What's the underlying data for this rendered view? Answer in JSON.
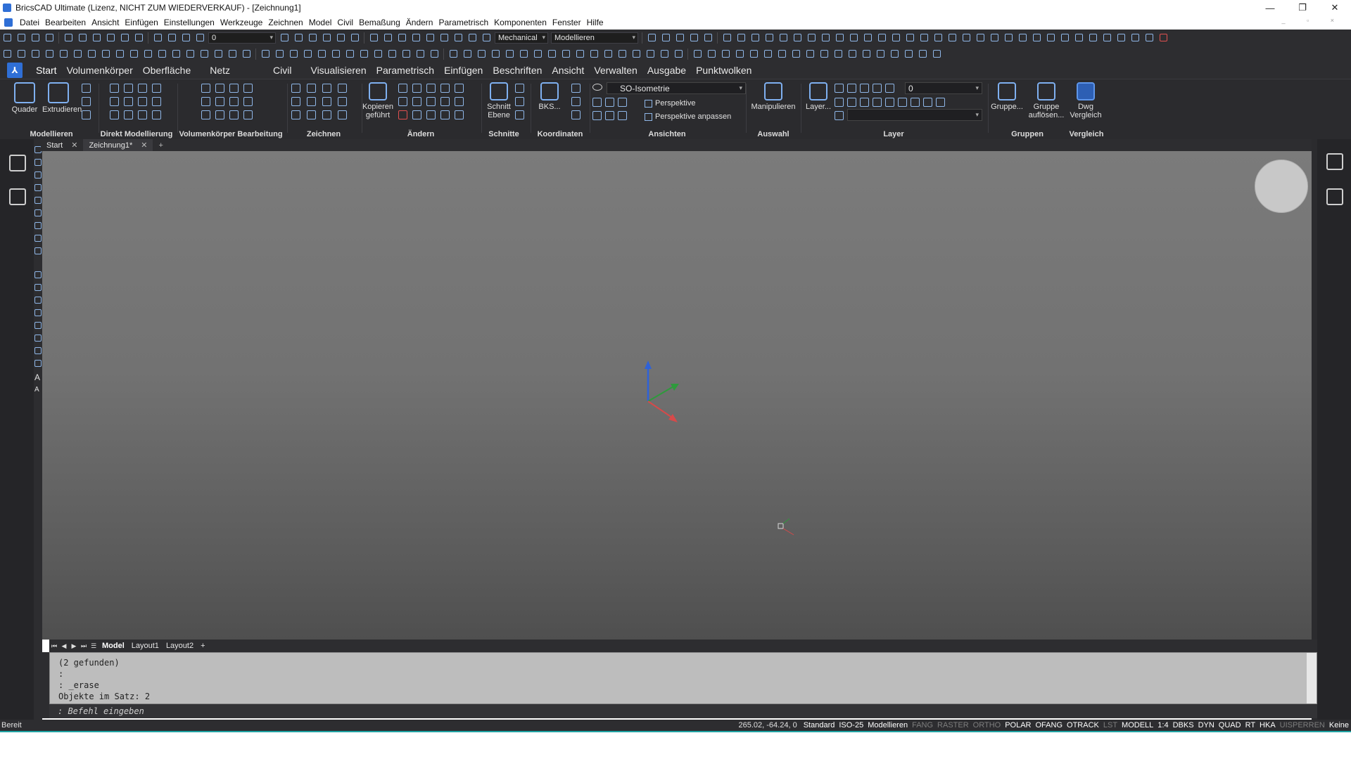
{
  "window": {
    "title": "BricsCAD Ultimate (Lizenz, NICHT ZUM WIEDERVERKAUF) - [Zeichnung1]",
    "controls": [
      "—",
      "❐",
      "✕"
    ]
  },
  "menubar": {
    "items": [
      "Datei",
      "Bearbeiten",
      "Ansicht",
      "Einfügen",
      "Einstellungen",
      "Werkzeuge",
      "Zeichnen",
      "Model",
      "Civil",
      "Bemaßung",
      "Ändern",
      "Parametrisch",
      "Komponenten",
      "Fenster",
      "Hilfe"
    ]
  },
  "toolbar": {
    "layer_value": "0",
    "workspace_value": "Mechanical",
    "mode_value": "Modellieren"
  },
  "ribbon_tabs": [
    "Start",
    "Volumenkörper",
    "Oberfläche",
    "Netz",
    "Civil",
    "Visualisieren",
    "Parametrisch",
    "Einfügen",
    "Beschriften",
    "Ansicht",
    "Verwalten",
    "Ausgabe",
    "Punktwolken"
  ],
  "ribbon": {
    "groups": [
      "Modellieren",
      "Direkt Modellierung",
      "Volumenkörper Bearbeitung",
      "Zeichnen",
      "Ändern",
      "Schnitte",
      "Koordinaten",
      "Ansichten",
      "Auswahl",
      "Layer",
      "Gruppen",
      "Vergleich"
    ],
    "buttons": {
      "quader": "Quader",
      "extrudieren": "Extrudieren",
      "kopieren": "Kopieren geführt",
      "schnitt": "Schnitt Ebene",
      "bks": "BKS...",
      "manipulieren": "Manipulieren",
      "layer": "Layer...",
      "gruppe": "Gruppe...",
      "gruppe_aufloesen": "Gruppe auflösen...",
      "dwg_vergleich": "Dwg Vergleich"
    },
    "view_combo": "SO-Isometrie",
    "perspektive": "Perspektive",
    "perspektive_anpassen": "Perspektive anpassen",
    "layer_combo": "0"
  },
  "doctabs": [
    {
      "label": "Start"
    },
    {
      "label": "Zeichnung1*"
    }
  ],
  "layout_tabs": [
    "Model",
    "Layout1",
    "Layout2"
  ],
  "command": {
    "history": [
      "(2 gefunden)",
      ":",
      ": _erase",
      "Objekte im Satz: 2"
    ],
    "prompt": ": Befehl eingeben"
  },
  "status": {
    "ready": "Bereit",
    "coords": "265.02, -64.24, 0",
    "items": [
      {
        "label": "Standard",
        "state": "on"
      },
      {
        "label": "ISO-25",
        "state": "on"
      },
      {
        "label": "Modellieren",
        "state": "on"
      },
      {
        "label": "FANG",
        "state": "off"
      },
      {
        "label": "RASTER",
        "state": "off"
      },
      {
        "label": "ORTHO",
        "state": "off"
      },
      {
        "label": "POLAR",
        "state": "on"
      },
      {
        "label": "OFANG",
        "state": "on"
      },
      {
        "label": "OTRACK",
        "state": "on"
      },
      {
        "label": "LST",
        "state": "off"
      },
      {
        "label": "MODELL",
        "state": "on"
      },
      {
        "label": "1:4",
        "state": "on"
      },
      {
        "label": "DBKS",
        "state": "on"
      },
      {
        "label": "DYN",
        "state": "on"
      },
      {
        "label": "QUAD",
        "state": "on"
      },
      {
        "label": "RT",
        "state": "on"
      },
      {
        "label": "HKA",
        "state": "on"
      },
      {
        "label": "UISPERREN",
        "state": "off"
      },
      {
        "label": "Keine",
        "state": "on"
      }
    ]
  },
  "colors": {
    "ucs_z": "#2f62d8",
    "ucs_y": "#2e9a3c",
    "ucs_x": "#d64a4a"
  }
}
